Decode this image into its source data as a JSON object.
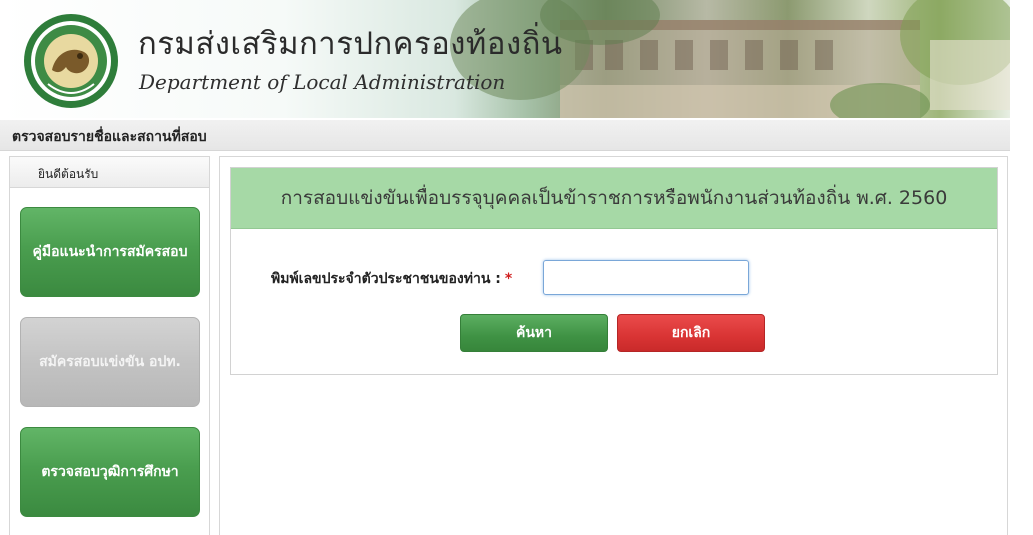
{
  "header": {
    "title_th": "กรมส่งเสริมการปกครองท้องถิ่น",
    "title_en": "Department of Local Administration",
    "logo_icon": "dla-seal-icon"
  },
  "subheader": {
    "title": "ตรวจสอบรายชื่อและสถานที่สอบ"
  },
  "sidebar": {
    "welcome": "ยินดีต้อนรับ",
    "items": [
      {
        "label": "คู่มือแนะนำการสมัครสอบ",
        "style": "green"
      },
      {
        "label": "สมัครสอบแข่งขัน อปท.",
        "style": "gray"
      },
      {
        "label": "ตรวจสอบวุฒิการศึกษา",
        "style": "green"
      }
    ]
  },
  "form": {
    "title": "การสอบแข่งขันเพื่อบรรจุบุคคลเป็นข้าราชการหรือพนักงานส่วนท้องถิ่น พ.ศ. 2560",
    "id_label": "พิมพ์เลขประจำตัวประชาชนของท่าน :",
    "required_mark": "*",
    "id_value": "",
    "search_button": "ค้นหา",
    "cancel_button": "ยกเลิก"
  },
  "colors": {
    "form_header_bg": "#a6d9a6",
    "green_button": "#4a9e4f",
    "red_button": "#d93434",
    "gray_button": "#c3c3c3"
  }
}
